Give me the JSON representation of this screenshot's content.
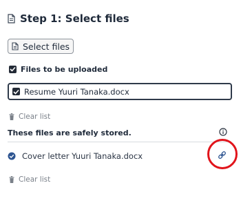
{
  "header": {
    "title": "Step 1: Select files",
    "icon": "document-icon"
  },
  "select_button": {
    "label": "Select files",
    "icon": "document-icon"
  },
  "upload_section": {
    "header_label": "Files to be uploaded",
    "header_checked": true,
    "files": [
      {
        "name": "Resume Yuuri Tanaka.docx",
        "checked": true
      }
    ],
    "clear_label": "Clear list"
  },
  "stored_section": {
    "header_label": "These files are safely stored.",
    "info_icon": "info-icon",
    "files": [
      {
        "name": "Cover letter Yuuri Tanaka.docx",
        "status_icon": "check-circle-icon",
        "action_icon": "link-icon"
      }
    ],
    "clear_label": "Clear list"
  },
  "colors": {
    "highlight": "#e1141b",
    "check_blue": "#2e5591",
    "text": "#1f2a3a",
    "muted": "#7a8089"
  }
}
